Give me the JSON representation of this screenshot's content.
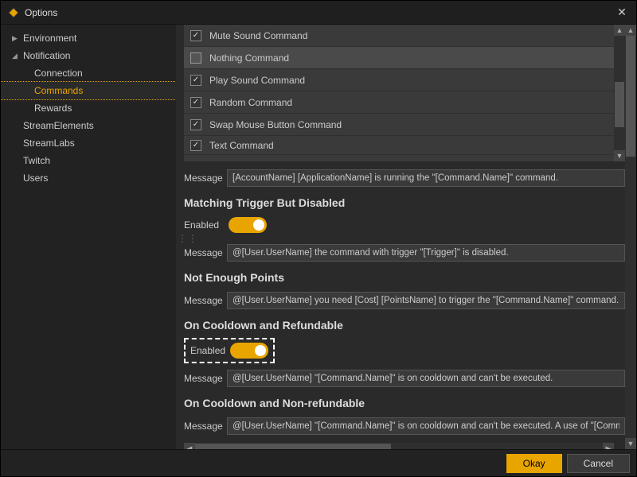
{
  "window": {
    "title": "Options"
  },
  "sidebar": {
    "items": [
      {
        "label": "Environment",
        "expanded": false
      },
      {
        "label": "Notification",
        "expanded": true,
        "children": [
          {
            "label": "Connection"
          },
          {
            "label": "Commands",
            "selected": true
          },
          {
            "label": "Rewards"
          }
        ]
      },
      {
        "label": "StreamElements"
      },
      {
        "label": "StreamLabs"
      },
      {
        "label": "Twitch"
      },
      {
        "label": "Users"
      }
    ]
  },
  "commands": [
    {
      "label": "Mute Sound Command",
      "checked": true
    },
    {
      "label": "Nothing Command",
      "checked": false,
      "selected": true
    },
    {
      "label": "Play Sound Command",
      "checked": true
    },
    {
      "label": "Random Command",
      "checked": true
    },
    {
      "label": "Swap Mouse Button Command",
      "checked": true
    },
    {
      "label": "Text Command",
      "checked": true
    }
  ],
  "sections": {
    "top_message": "[AccountName] [ApplicationName] is running the \"[Command.Name]\" command.",
    "matching": {
      "title": "Matching Trigger But Disabled",
      "enabled_label": "Enabled",
      "message_label": "Message",
      "message": "@[User.UserName] the command with trigger \"[Trigger]\" is disabled."
    },
    "points": {
      "title": "Not Enough Points",
      "message_label": "Message",
      "message": "@[User.UserName] you need [Cost] [PointsName] to trigger the \"[Command.Name]\" command."
    },
    "cooldown_ref": {
      "title": "On Cooldown and Refundable",
      "enabled_label": "Enabled",
      "message_label": "Message",
      "message": "@[User.UserName] \"[Command.Name]\" is on cooldown and can't be executed."
    },
    "cooldown_nonref": {
      "title": "On Cooldown and Non-refundable",
      "message_label": "Message",
      "message": "@[User.UserName] \"[Command.Name]\" is on cooldown and can't be executed. A use of \"[Command.N"
    }
  },
  "footer": {
    "okay": "Okay",
    "cancel": "Cancel"
  },
  "labels": {
    "message": "Message"
  }
}
